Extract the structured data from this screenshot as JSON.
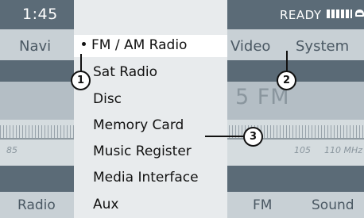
{
  "status_bar": {
    "time": "1:45",
    "ready": "READY"
  },
  "nav": {
    "left": "Navi",
    "video": "Video",
    "system": "System"
  },
  "radio": {
    "frequency_partial": "5 FM"
  },
  "scale": {
    "left_label": "85",
    "mid_label": "105",
    "right_label": "110 MHz"
  },
  "bottom": {
    "radio": "Radio",
    "fm": "FM",
    "sound": "Sound"
  },
  "menu": {
    "items": [
      {
        "label": "FM / AM Radio",
        "selected": true
      },
      {
        "label": "Sat Radio"
      },
      {
        "label": "Disc"
      },
      {
        "label": "Memory Card"
      },
      {
        "label": "Music Register"
      },
      {
        "label": "Media Interface"
      },
      {
        "label": "Aux"
      }
    ]
  },
  "callouts": [
    "1",
    "2",
    "3"
  ]
}
